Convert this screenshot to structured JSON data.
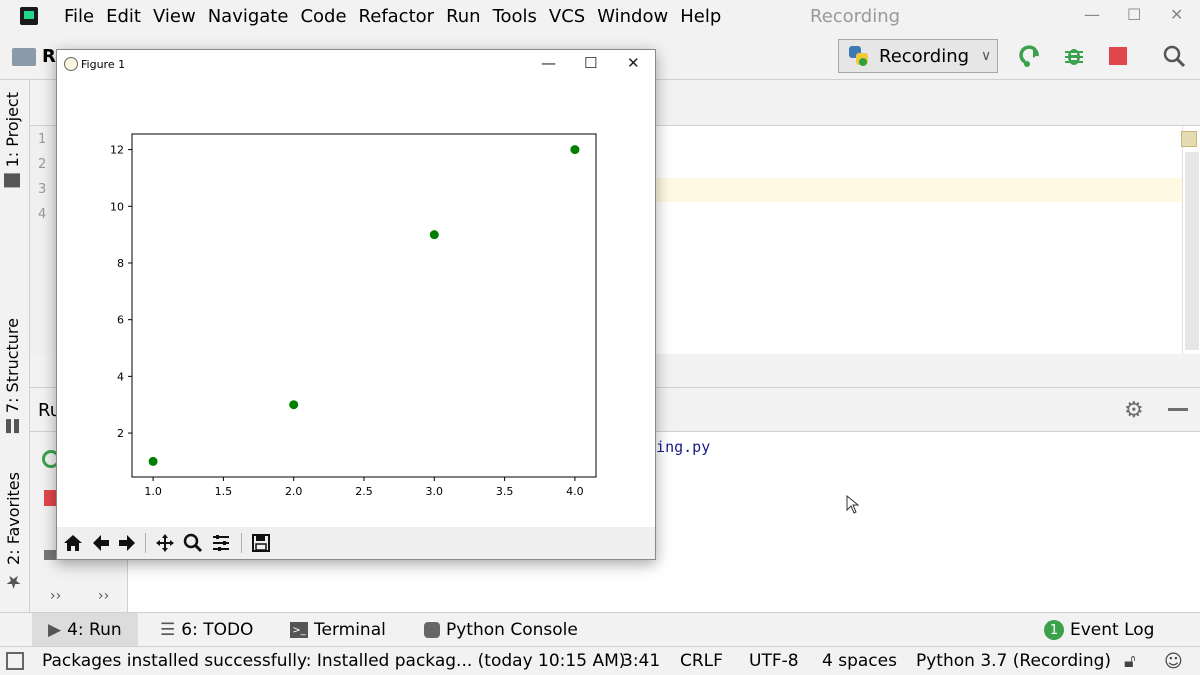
{
  "menubar": {
    "items": [
      "File",
      "Edit",
      "View",
      "Navigate",
      "Code",
      "Refactor",
      "Run",
      "Tools",
      "VCS",
      "Window",
      "Help"
    ],
    "window_title": "Recording"
  },
  "toolbar": {
    "breadcrumb": "R",
    "run_config": "Recording"
  },
  "left_tabs": {
    "project": "1: Project",
    "structure": "7: Structure",
    "favorites": "2: Favorites"
  },
  "editor": {
    "line_numbers": [
      "1",
      "2",
      "3",
      "4"
    ]
  },
  "run_panel": {
    "title": "Ru",
    "console_text": "rding.py",
    "side_chevron": "››",
    "side_chevron2": "››"
  },
  "tool_tabs": {
    "run": "4: Run",
    "todo": "6: TODO",
    "terminal": "Terminal",
    "python_console": "Python Console",
    "event_log": "Event Log",
    "event_log_count": "1"
  },
  "statusbar": {
    "message": "Packages installed successfully: Installed packag... (today 10:15 AM)",
    "position": "3:41",
    "line_sep": "CRLF",
    "encoding": "UTF-8",
    "indent": "4 spaces",
    "interpreter": "Python 3.7 (Recording)"
  },
  "figure": {
    "title": "Figure 1"
  },
  "chart_data": {
    "type": "scatter",
    "x": [
      1,
      2,
      3,
      4
    ],
    "y": [
      1,
      3,
      9,
      12
    ],
    "marker_color": "#008000",
    "xlim": [
      0.85,
      4.15
    ],
    "ylim": [
      0.45,
      12.55
    ],
    "xticks": [
      1.0,
      1.5,
      2.0,
      2.5,
      3.0,
      3.5,
      4.0
    ],
    "xtick_labels": [
      "1.0",
      "1.5",
      "2.0",
      "2.5",
      "3.0",
      "3.5",
      "4.0"
    ],
    "yticks": [
      2,
      4,
      6,
      8,
      10,
      12
    ],
    "ytick_labels": [
      "2",
      "4",
      "6",
      "8",
      "10",
      "12"
    ],
    "title": "",
    "xlabel": "",
    "ylabel": "",
    "grid": false
  }
}
